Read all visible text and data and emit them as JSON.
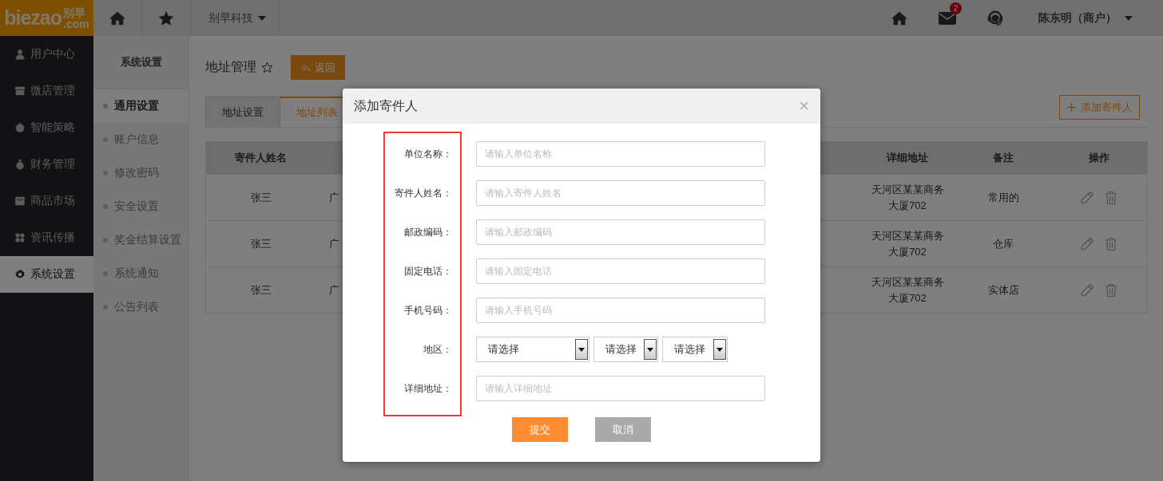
{
  "header": {
    "logo": {
      "wordmark": "biezao",
      "chinese": "别早",
      "domain": ".com"
    },
    "company_menu": "别早科技",
    "message_count": "2",
    "user_menu": "陈东明（商户）"
  },
  "sidebar": {
    "items": [
      {
        "label": "用户中心",
        "selected": false
      },
      {
        "label": "微店管理",
        "selected": false
      },
      {
        "label": "智能策略",
        "selected": false
      },
      {
        "label": "财务管理",
        "selected": false
      },
      {
        "label": "商品市场",
        "selected": false
      },
      {
        "label": "资讯传播",
        "selected": false
      },
      {
        "label": "系统设置",
        "selected": true
      }
    ]
  },
  "subnav": {
    "title": "系统设置",
    "items": [
      {
        "label": "通用设置",
        "selected": true
      },
      {
        "label": "账户信息",
        "selected": false
      },
      {
        "label": "修改密码",
        "selected": false
      },
      {
        "label": "安全设置",
        "selected": false
      },
      {
        "label": "奖金结算设置",
        "selected": false
      },
      {
        "label": "系统通知",
        "selected": false
      },
      {
        "label": "公告列表",
        "selected": false
      }
    ]
  },
  "page": {
    "title": "地址管理",
    "back_button": "返回",
    "tabs": [
      {
        "label": "地址设置",
        "selected": false
      },
      {
        "label": "地址列表",
        "selected": true
      }
    ],
    "add_button": "添加寄件人",
    "table": {
      "columns": [
        "寄件人姓名",
        "详细地址",
        "备注",
        "操作"
      ],
      "rows": [
        {
          "sender": "张三",
          "column_2": "广",
          "address": "天河区某某商务大厦702",
          "note": "常用的"
        },
        {
          "sender": "张三",
          "column_2": "广",
          "address": "天河区某某商务大厦702",
          "note": "仓库"
        },
        {
          "sender": "张三",
          "column_2": "广",
          "address": "天河区某某商务大厦702",
          "note": "实体店"
        }
      ]
    }
  },
  "dialog": {
    "title": "添加寄件人",
    "close": "×",
    "fields": [
      {
        "kind": "text",
        "label": "单位名称：",
        "placeholder": "请输入单位名称"
      },
      {
        "kind": "text",
        "label": "寄件人姓名：",
        "placeholder": "请输入寄件人姓名"
      },
      {
        "kind": "text",
        "label": "邮政编码：",
        "placeholder": "请输入邮政编码"
      },
      {
        "kind": "text",
        "label": "固定电话：",
        "placeholder": "请输入固定电话"
      },
      {
        "kind": "text",
        "label": "手机号码：",
        "placeholder": "请输入手机号码"
      },
      {
        "kind": "select",
        "label": "地区：",
        "selects": [
          "请选择",
          "请选择",
          "请选择"
        ]
      },
      {
        "kind": "text",
        "label": "详细地址：",
        "placeholder": "请输入详细地址"
      }
    ],
    "buttons": [
      {
        "label": "提交",
        "kind": "primary"
      },
      {
        "label": "取消",
        "kind": "secondary"
      }
    ]
  }
}
